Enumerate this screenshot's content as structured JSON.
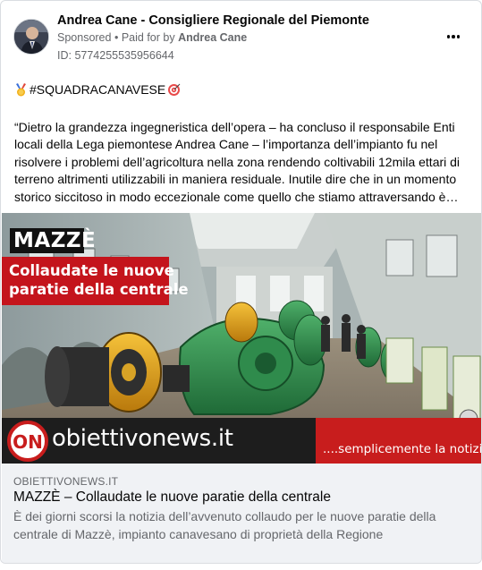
{
  "post": {
    "page_name": "Andrea Cane - Consigliere Regionale del Piemonte",
    "sponsored_label": "Sponsored",
    "separator": "•",
    "paid_for_by_prefix": "Paid for by",
    "paid_for_by_name": "Andrea Cane",
    "ad_id": "ID: 5774255535956644",
    "more_icon": "more-options-icon"
  },
  "content": {
    "hashtag": "#SQUADRACANAVESE",
    "hashtag_icons": [
      "medal-icon",
      "target-icon"
    ],
    "paragraph_lines": [
      "“Dietro la grandezza ingegneristica dell’opera – ha concluso il responsabile Enti",
      "locali della Lega piemontese Andrea Cane – l’importanza dell’impianto fu nel",
      "risolvere i problemi dell’agricoltura nella zona rendendo coltivabili 12mila ettari di",
      "terreno altrimenti utilizzabili in maniera residuale. Inutile dire che in un momento",
      "storico siccitoso in modo eccezionale come quello che stiamo attraversando è…"
    ]
  },
  "image": {
    "place_label": "MAZZÈ",
    "headline_lines": [
      "Collaudate le nuove",
      "paratie della centrale"
    ],
    "brand": "obiettivonews.it",
    "tagline": "....semplicemente la notizia",
    "logo_letters": "ON"
  },
  "link_preview": {
    "domain": "OBIETTIVONEWS.IT",
    "title": "MAZZÈ – Collaudate le nuove paratie della centrale",
    "description": "È dei giorni scorsi la notizia dell’avvenuto collaudo per le nuove paratie della centrale di Mazzè, impianto canavesano di proprietà della Regione"
  },
  "colors": {
    "banner_red": "#c4141c",
    "text_primary": "#050505",
    "text_secondary": "#65676b",
    "link_box_bg": "#f0f2f5",
    "turbine_green": "#2e8b4a",
    "turbine_yellow": "#e0a21a"
  }
}
